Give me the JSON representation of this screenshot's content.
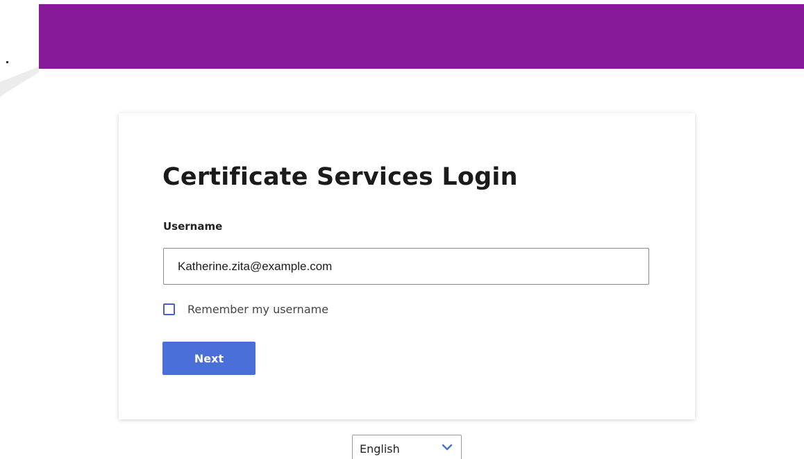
{
  "brand": {
    "header_color": "#861a99",
    "accent_color": "#4a6fd8"
  },
  "login": {
    "title": "Certificate Services Login",
    "username_label": "Username",
    "username_value": "Katherine.zita@example.com",
    "remember_label": "Remember my username",
    "remember_checked": false,
    "next_label": "Next"
  },
  "language": {
    "selected": "English",
    "icon": "chevron-down-icon"
  }
}
